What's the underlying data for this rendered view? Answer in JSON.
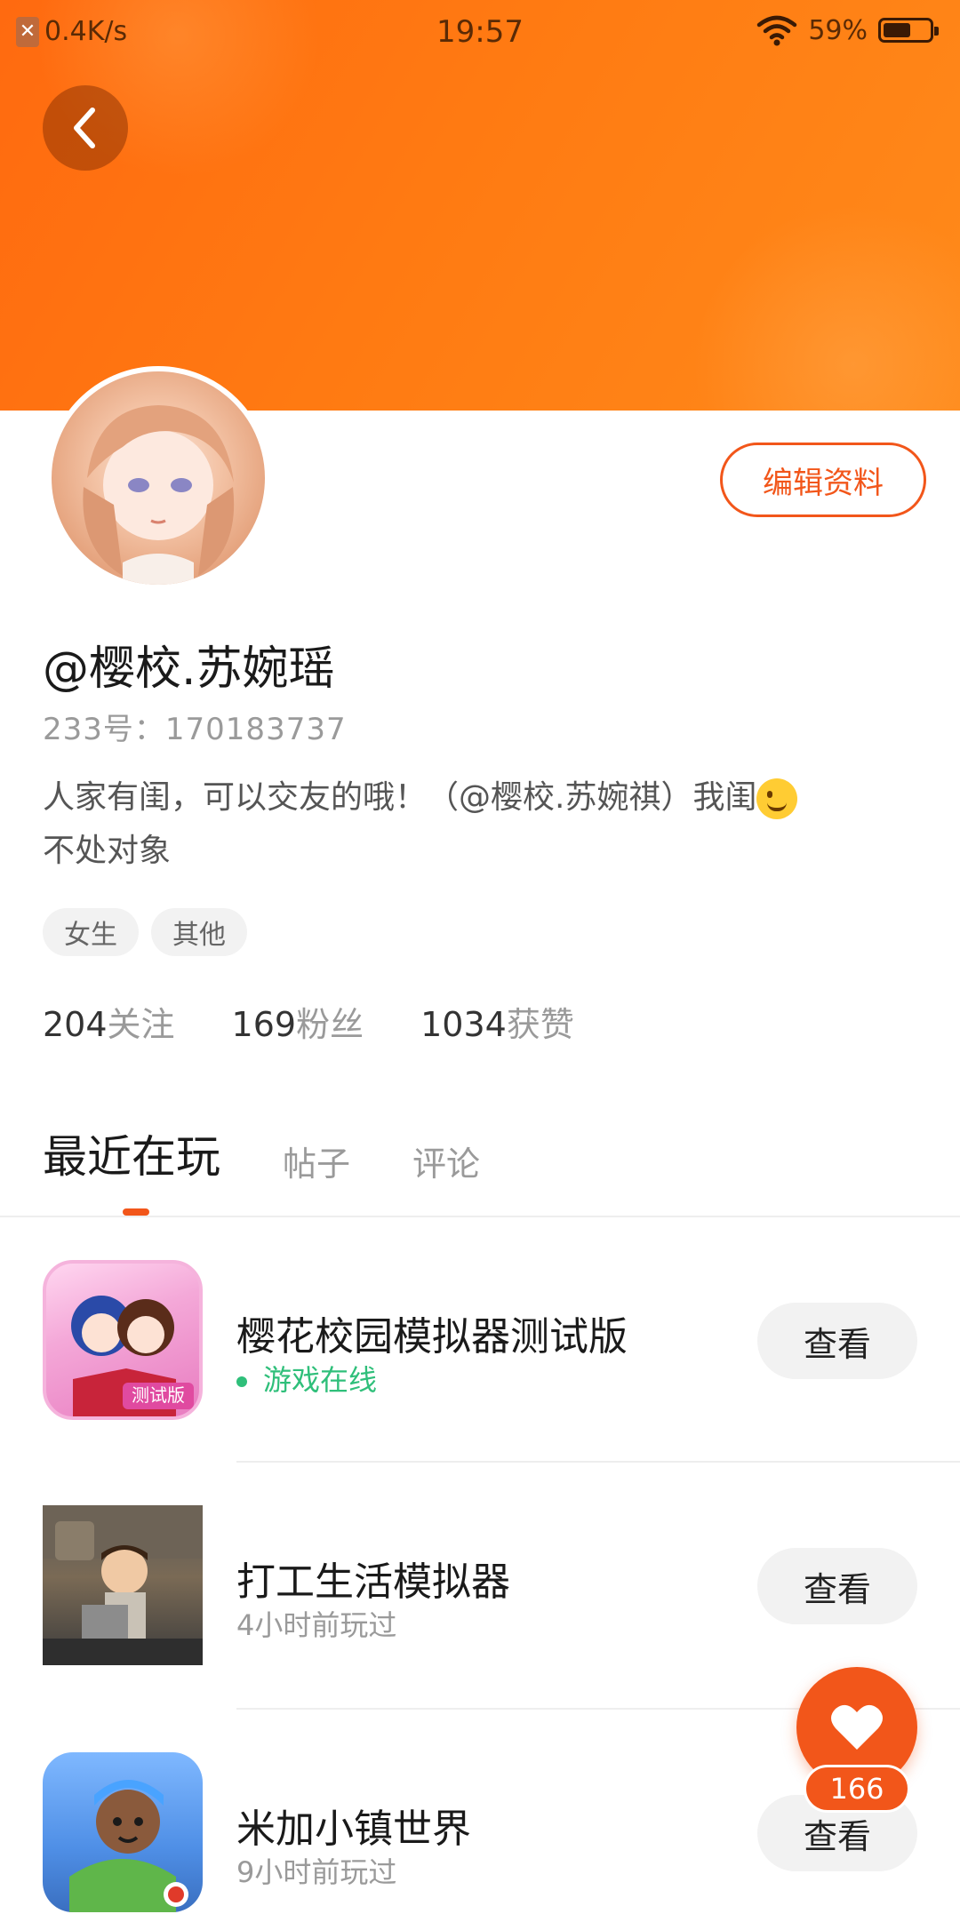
{
  "status_bar": {
    "net_speed": "0.4K/s",
    "time": "19:57",
    "battery_percent": "59%",
    "battery_level": 0.59
  },
  "profile": {
    "username": "@樱校.苏婉瑶",
    "id_label": "233号：",
    "id_value": "170183737",
    "bio_line1": "人家有闺，可以交友的哦！（@樱校.苏婉祺）我闺",
    "bio_line2": "不处对象",
    "edit_label": "编辑资料",
    "tags": [
      "女生",
      "其他"
    ],
    "stats": [
      {
        "num": "204",
        "label": "关注"
      },
      {
        "num": "169",
        "label": "粉丝"
      },
      {
        "num": "1034",
        "label": "获赞"
      }
    ]
  },
  "tabs": [
    "最近在玩",
    "帖子",
    "评论"
  ],
  "games": [
    {
      "title": "樱花校园模拟器测试版",
      "status": "游戏在线",
      "online": true,
      "button": "查看",
      "icon_badge": "测试版"
    },
    {
      "title": "打工生活模拟器",
      "status": "4小时前玩过",
      "online": false,
      "button": "查看"
    },
    {
      "title": "米加小镇世界",
      "status": "9小时前玩过",
      "online": false,
      "button": "查看"
    }
  ],
  "like": {
    "count": "166"
  },
  "colors": {
    "accent": "#f2561a",
    "banner": "#ff7a12",
    "online": "#2fbf7a"
  }
}
